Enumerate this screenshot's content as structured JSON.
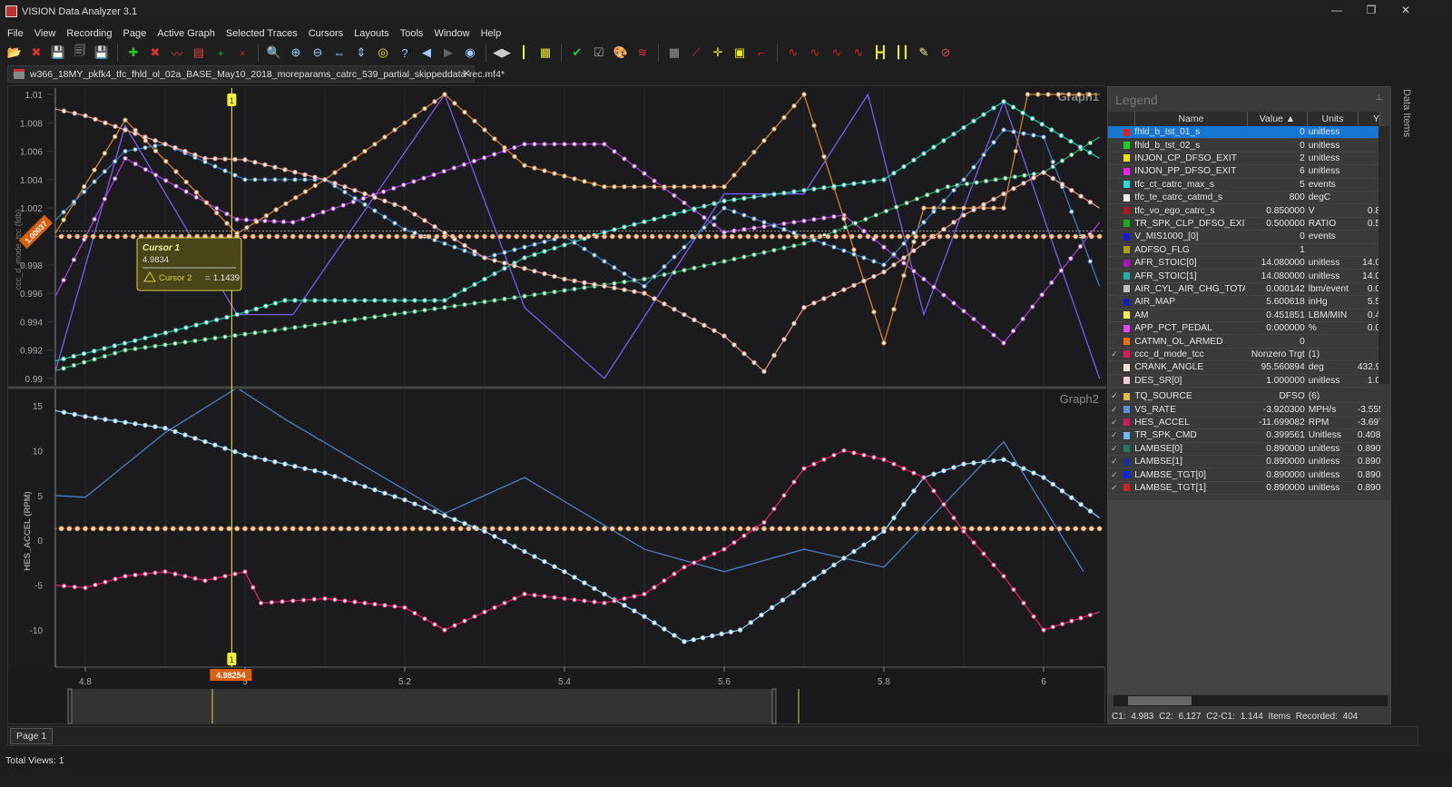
{
  "app": {
    "title": "VISION Data Analyzer 3.1",
    "window_buttons": [
      "—",
      "❐",
      "✕"
    ]
  },
  "menu": [
    "File",
    "View",
    "Recording",
    "Page",
    "Active Graph",
    "Selected Traces",
    "Cursors",
    "Layouts",
    "Tools",
    "Window",
    "Help"
  ],
  "toolbar": {
    "icons": [
      {
        "name": "open-folder-icon",
        "glyph": "📂",
        "color": "#e0a030"
      },
      {
        "name": "close-recording-icon",
        "glyph": "✖",
        "color": "#d33"
      },
      {
        "name": "save-icon",
        "glyph": "💾",
        "color": "#8aa"
      },
      {
        "name": "save-all-icon",
        "glyph": "🗐",
        "color": "#aaa"
      },
      {
        "name": "save-as-icon",
        "glyph": "💾",
        "color": "#999"
      },
      {
        "sep": true
      },
      {
        "name": "add-graph-icon",
        "glyph": "✚",
        "color": "#2c2"
      },
      {
        "name": "remove-graph-icon",
        "glyph": "✖",
        "color": "#d33"
      },
      {
        "name": "graph-format-icon",
        "glyph": "〰",
        "color": "#d44"
      },
      {
        "name": "graph-table-icon",
        "glyph": "▤",
        "color": "#d44"
      },
      {
        "name": "add-y-axis-icon",
        "glyph": "+",
        "color": "#2a2"
      },
      {
        "name": "remove-y-axis-icon",
        "glyph": "×",
        "color": "#a22"
      },
      {
        "sep": true
      },
      {
        "name": "zoom-fit-icon",
        "glyph": "🔍",
        "color": "#9cf"
      },
      {
        "name": "zoom-in-icon",
        "glyph": "⊕",
        "color": "#9cf"
      },
      {
        "name": "zoom-out-icon",
        "glyph": "⊖",
        "color": "#9cf"
      },
      {
        "name": "zoom-x-icon",
        "glyph": "⇔",
        "color": "#9cf"
      },
      {
        "name": "zoom-y-icon",
        "glyph": "⇕",
        "color": "#9cf"
      },
      {
        "name": "zoom-cursors-icon",
        "glyph": "◎",
        "color": "#ee3"
      },
      {
        "name": "zoom-help-icon",
        "glyph": "?",
        "color": "#9cf"
      },
      {
        "name": "zoom-back-icon",
        "glyph": "◀",
        "color": "#9cf"
      },
      {
        "name": "zoom-forward-icon",
        "glyph": "▶",
        "color": "#666"
      },
      {
        "name": "zoom-page-icon",
        "glyph": "◉",
        "color": "#9cf"
      },
      {
        "sep": true
      },
      {
        "name": "cursor-left-right-icon",
        "glyph": "◀▶",
        "color": "#ccc"
      },
      {
        "name": "cursor-value-icon",
        "glyph": "┃",
        "color": "#ee3"
      },
      {
        "name": "cursor-table-icon",
        "glyph": "▦",
        "color": "#ee3"
      },
      {
        "sep": true
      },
      {
        "name": "trace-select-icon",
        "glyph": "✔",
        "color": "#3c3"
      },
      {
        "name": "trace-check-icon",
        "glyph": "☑",
        "color": "#aaa"
      },
      {
        "name": "palette-icon",
        "glyph": "🎨",
        "color": "#dd8"
      },
      {
        "name": "trace-lines-icon",
        "glyph": "≋",
        "color": "#d33"
      },
      {
        "sep": true
      },
      {
        "name": "grid-icon",
        "glyph": "▦",
        "color": "#999"
      },
      {
        "name": "point-markers-icon",
        "glyph": "⟋",
        "color": "#d33"
      },
      {
        "name": "crosshair-icon",
        "glyph": "✛",
        "color": "#ee2"
      },
      {
        "name": "point-label-icon",
        "glyph": "▣",
        "color": "#ee2"
      },
      {
        "name": "step-line-icon",
        "glyph": "⌐",
        "color": "#d22"
      },
      {
        "sep": true
      },
      {
        "name": "wave-icon",
        "glyph": "∿",
        "color": "#d22"
      },
      {
        "name": "wave-small-icon",
        "glyph": "∿",
        "color": "#d22"
      },
      {
        "name": "wave-axis-icon",
        "glyph": "∿",
        "color": "#d22"
      },
      {
        "name": "wave-stack-icon",
        "glyph": "∿",
        "color": "#d22"
      },
      {
        "name": "cursor-pair-icon",
        "glyph": "┣┫",
        "color": "#ee2"
      },
      {
        "name": "multi-cursor-icon",
        "glyph": "┃┃",
        "color": "#ee2"
      },
      {
        "name": "notes-icon",
        "glyph": "✎",
        "color": "#ee8"
      },
      {
        "name": "hide-icon",
        "glyph": "⊘",
        "color": "#d44"
      }
    ]
  },
  "tab": {
    "label": "w366_18MY_pkfk4_tfc_fhld_ol_02a_BASE_May10_2018_moreparams_catrc_539_partial_skippeddata-rec.mf4*",
    "close": "✕"
  },
  "graph1": {
    "title": "Graph1",
    "ylabel": "ccc_d_mode_tcc (fdb)",
    "yticks": [
      "1.01",
      "1.008",
      "1.006",
      "1.004",
      "1.002",
      "0.998",
      "0.996",
      "0.994",
      "0.992",
      "0.99"
    ],
    "cursor_value_tag": "1.00037"
  },
  "graph2": {
    "title": "Graph2",
    "ylabel": "HES_ACCEL (RPM)",
    "yticks": [
      "15",
      "10",
      "5",
      "0",
      "-5",
      "-10"
    ]
  },
  "xaxis": {
    "ticks": [
      "4.8",
      "5",
      "5.2",
      "5.4",
      "5.6",
      "5.8",
      "6"
    ],
    "cursor_tag": "4.98254"
  },
  "cursor_tooltip": {
    "title": "Cursor 1",
    "value": "4.9834",
    "delta_label": "Cursor 2",
    "equals": "=",
    "delta_value": "1.1439"
  },
  "cursor_marker": "1",
  "chart_data": [
    {
      "type": "line",
      "title": "Graph1",
      "ylabel": "ccc_d_mode_tcc (fdb)",
      "xlim": [
        4.7625,
        6.076
      ],
      "ylim": [
        0.9895,
        1.0105
      ],
      "grid": true,
      "series": [
        {
          "color": "#7a5af0",
          "markers": false,
          "x": [
            4.76,
            4.85,
            4.99,
            5.06,
            5.25,
            5.35,
            5.45,
            5.6,
            5.7,
            5.78,
            5.85,
            5.95,
            6.07
          ],
          "y": [
            0.99,
            1.0078,
            0.9945,
            0.9945,
            1.01,
            0.995,
            0.99,
            1.003,
            1.003,
            1.01,
            0.9945,
            1.0095,
            0.99
          ]
        },
        {
          "color": "#a040d0",
          "markers": true,
          "x": [
            4.76,
            4.85,
            4.99,
            5.06,
            5.35,
            5.45,
            5.6,
            5.75,
            5.95,
            6.07
          ],
          "y": [
            0.9955,
            1.0055,
            1.0012,
            1.001,
            1.0065,
            1.0065,
            1.0003,
            1.0015,
            0.9925,
            1.001
          ]
        },
        {
          "color": "#d08030",
          "markers": true,
          "x": [
            4.76,
            4.85,
            4.99,
            5.1,
            5.25,
            5.35,
            5.45,
            5.6,
            5.7,
            5.8,
            5.85,
            5.95,
            5.98,
            6.07
          ],
          "y": [
            1.0,
            1.0082,
            1.0002,
            1.004,
            1.01,
            1.005,
            1.0035,
            1.0035,
            1.01,
            0.9925,
            1.002,
            1.002,
            1.01,
            1.01
          ]
        },
        {
          "color": "#2aa060",
          "markers": true,
          "x": [
            4.76,
            4.85,
            5.05,
            5.25,
            5.5,
            5.7,
            5.88,
            6.0,
            6.07
          ],
          "y": [
            0.9905,
            0.992,
            0.9935,
            0.995,
            0.997,
            0.9995,
            1.0035,
            1.0045,
            1.007
          ]
        },
        {
          "color": "#20c0a0",
          "markers": true,
          "x": [
            4.76,
            4.99,
            5.05,
            5.25,
            5.35,
            5.45,
            5.6,
            5.8,
            5.95,
            6.07
          ],
          "y": [
            0.9912,
            0.9945,
            0.9955,
            0.9955,
            0.9985,
            1.0003,
            1.0025,
            1.004,
            1.0095,
            1.0055
          ]
        },
        {
          "color": "#3a78b8",
          "markers": true,
          "x": [
            4.76,
            4.85,
            4.9,
            5.0,
            5.1,
            5.2,
            5.3,
            5.4,
            5.5,
            5.6,
            5.7,
            5.8,
            5.9,
            5.95,
            6.0,
            6.07
          ],
          "y": [
            1.001,
            1.006,
            1.0065,
            1.004,
            1.004,
            1.0005,
            0.9985,
            1.0,
            0.9965,
            1.002,
            1.0,
            0.998,
            1.004,
            1.0075,
            1.007,
            0.9965
          ]
        },
        {
          "color": "#d89080",
          "markers": true,
          "x": [
            4.76,
            4.8,
            4.85,
            4.9,
            4.95,
            5.0,
            5.1,
            5.2,
            5.3,
            5.4,
            5.5,
            5.6,
            5.65,
            5.7,
            5.8,
            5.9,
            6.0,
            6.07
          ],
          "y": [
            1.009,
            1.0085,
            1.0075,
            1.0065,
            1.0055,
            1.0054,
            1.004,
            1.002,
            0.9985,
            0.997,
            0.996,
            0.993,
            0.9905,
            0.995,
            0.9975,
            1.0015,
            1.0045,
            1.002
          ]
        },
        {
          "color": "#e0a050",
          "markers": true,
          "dense": true,
          "x": [
            4.76,
            6.07
          ],
          "y": [
            1.0,
            1.0
          ]
        }
      ]
    },
    {
      "type": "line",
      "title": "Graph2",
      "ylabel": "HES_ACCEL (RPM)",
      "xlim": [
        4.7625,
        6.076
      ],
      "ylim": [
        -14,
        16.5
      ],
      "grid": true,
      "series": [
        {
          "name": "TR_SPK_CMD",
          "color": "#4a80c0",
          "markers": false,
          "x": [
            4.76,
            4.8,
            4.9,
            4.99,
            5.05,
            5.25,
            5.35,
            5.5,
            5.6,
            5.7,
            5.8,
            5.95,
            6.05
          ],
          "y": [
            5,
            4.8,
            12,
            17,
            13.5,
            3,
            7,
            -1,
            -3.5,
            -1,
            -3,
            11,
            -3.5
          ]
        },
        {
          "name": "TQ_SOURCE",
          "color": "#e0b060",
          "markers": true,
          "dense": true,
          "x": [
            4.76,
            6.07
          ],
          "y": [
            1.3,
            1.3
          ]
        },
        {
          "name": "VS_RATE",
          "color": "#8ac8f0",
          "markers": true,
          "x": [
            4.76,
            4.8,
            4.9,
            5.0,
            5.1,
            5.2,
            5.3,
            5.4,
            5.5,
            5.55,
            5.62,
            5.7,
            5.8,
            5.85,
            5.9,
            5.95,
            6.0,
            6.07
          ],
          "y": [
            14.5,
            13.8,
            12.5,
            9.5,
            7.5,
            4.5,
            1,
            -3.5,
            -8.5,
            -11.3,
            -10,
            -5,
            1,
            7,
            8.5,
            9,
            7,
            2.5
          ]
        },
        {
          "name": "HES_ACCEL",
          "color": "#e0206a",
          "markers": true,
          "x": [
            4.76,
            4.8,
            4.85,
            4.9,
            4.95,
            5.0,
            5.02,
            5.1,
            5.2,
            5.25,
            5.35,
            5.45,
            5.5,
            5.55,
            5.6,
            5.65,
            5.7,
            5.75,
            5.8,
            5.85,
            5.9,
            5.95,
            6.0,
            6.07
          ],
          "y": [
            -5,
            -5.3,
            -4,
            -3.5,
            -4.5,
            -3.5,
            -7,
            -6.5,
            -7.5,
            -10,
            -6,
            -7,
            -6,
            -3,
            -1,
            2,
            8,
            10,
            9,
            7,
            1,
            -4,
            -10,
            -8
          ]
        }
      ]
    }
  ],
  "legend": {
    "title": "Legend",
    "pin": "⊥",
    "columns": [
      "Name",
      "Value ▲",
      "Units",
      "Y"
    ],
    "rows": [
      {
        "checked": false,
        "color": "#e02020",
        "name": "fhld_b_tst_01_s",
        "value": "0",
        "units": "unitless",
        "y": "",
        "selected": true
      },
      {
        "checked": false,
        "color": "#20d020",
        "name": "fhld_b_tst_02_s",
        "value": "0",
        "units": "unitless",
        "y": ""
      },
      {
        "checked": false,
        "color": "#f0e010",
        "name": "INJON_CP_DFSO_EXIT",
        "value": "2",
        "units": "unitless",
        "y": ""
      },
      {
        "checked": false,
        "color": "#f020f0",
        "name": "INJON_PP_DFSO_EXIT",
        "value": "6",
        "units": "unitless",
        "y": ""
      },
      {
        "checked": false,
        "color": "#20e0e0",
        "name": "tfc_ct_catrc_max_s",
        "value": "5",
        "units": "events",
        "y": ""
      },
      {
        "checked": false,
        "color": "#f0f0f0",
        "name": "tfc_te_catrc_catmd_s",
        "value": "800",
        "units": "degC",
        "y": ""
      },
      {
        "checked": false,
        "color": "#b01818",
        "name": "tfc_vo_ego_catrc_s",
        "value": "0.850000",
        "units": "V",
        "y": "0.8"
      },
      {
        "checked": false,
        "color": "#18b018",
        "name": "TR_SPK_CLP_DFSO_EXIT",
        "value": "0.500000",
        "units": "RATIO",
        "y": "0.5"
      },
      {
        "checked": false,
        "color": "#1818e0",
        "name": "V_MIS1000_[0]",
        "value": "0",
        "units": "events",
        "y": ""
      },
      {
        "checked": false,
        "color": "#b0a010",
        "name": "ADFSO_FLG",
        "value": "1",
        "units": "",
        "y": ""
      },
      {
        "checked": false,
        "color": "#b010c0",
        "name": "AFR_STOIC[0]",
        "value": "14.080000",
        "units": "unitless",
        "y": "14.0"
      },
      {
        "checked": false,
        "color": "#20b0a8",
        "name": "AFR_STOIC[1]",
        "value": "14.080000",
        "units": "unitless",
        "y": "14.0"
      },
      {
        "checked": false,
        "color": "#c0c0c0",
        "name": "AIR_CYL_AIR_CHG_TOTAL",
        "value": "0.000142",
        "units": "lbm/event",
        "y": "0.0"
      },
      {
        "checked": false,
        "color": "#1020b0",
        "name": "AIR_MAP",
        "value": "5.600618",
        "units": "inHg",
        "y": "5.5"
      },
      {
        "checked": false,
        "color": "#f0f050",
        "name": "AM",
        "value": "0.451851",
        "units": "LBM/MIN",
        "y": "0.4"
      },
      {
        "checked": false,
        "color": "#f040f0",
        "name": "APP_PCT_PEDAL",
        "value": "0.000000",
        "units": "%",
        "y": "0.0"
      },
      {
        "checked": false,
        "color": "#f07010",
        "name": "CATMN_OL_ARMED",
        "value": "0",
        "units": "",
        "y": ""
      },
      {
        "checked": true,
        "color": "#e01860",
        "name": "ccc_d_mode_tcc",
        "value": "Nonzero Trgt",
        "units": "(1)",
        "y": ""
      },
      {
        "checked": false,
        "color": "#f8e0d8",
        "name": "CRANK_ANGLE",
        "value": "95.560894",
        "units": "deg",
        "y": "432.9"
      },
      {
        "checked": false,
        "color": "#f8c8d8",
        "name": "DES_SR[0]",
        "value": "1.000000",
        "units": "unitless",
        "y": "1.0"
      }
    ],
    "graph2_rows": [
      {
        "checked": true,
        "color": "#e8b850",
        "name": "TQ_SOURCE",
        "value": "DFSO",
        "units": "(6)",
        "y": ""
      },
      {
        "checked": true,
        "color": "#5a90e0",
        "name": "VS_RATE",
        "value": "-3.920300",
        "units": "MPH/s",
        "y": "-3.555"
      },
      {
        "checked": true,
        "color": "#d01860",
        "name": "HES_ACCEL",
        "value": "-11.699082",
        "units": "RPM",
        "y": "-3.697"
      },
      {
        "checked": true,
        "color": "#70b8f0",
        "name": "TR_SPK_CMD",
        "value": "0.399561",
        "units": "Unitless",
        "y": "0.408"
      },
      {
        "checked": true,
        "color": "#207860",
        "name": "LAMBSE[0]",
        "value": "0.890000",
        "units": "unitless",
        "y": "0.890"
      },
      {
        "checked": true,
        "color": "#1830a0",
        "name": "LAMBSE[1]",
        "value": "0.890000",
        "units": "unitless",
        "y": "0.890"
      },
      {
        "checked": true,
        "color": "#1020f0",
        "name": "LAMBSE_TGT[0]",
        "value": "0.890000",
        "units": "unitless",
        "y": "0.890"
      },
      {
        "checked": true,
        "color": "#d02020",
        "name": "LAMBSE_TGT[1]",
        "value": "0.890000",
        "units": "unitless",
        "y": "0.890"
      }
    ],
    "status": "C1: 4.983   C2: 6.127   C2-C1: 1.144   Items Recorded: 404"
  },
  "side_tab": "Data Items",
  "page_tab": "Page 1",
  "status": "Total Views: 1"
}
